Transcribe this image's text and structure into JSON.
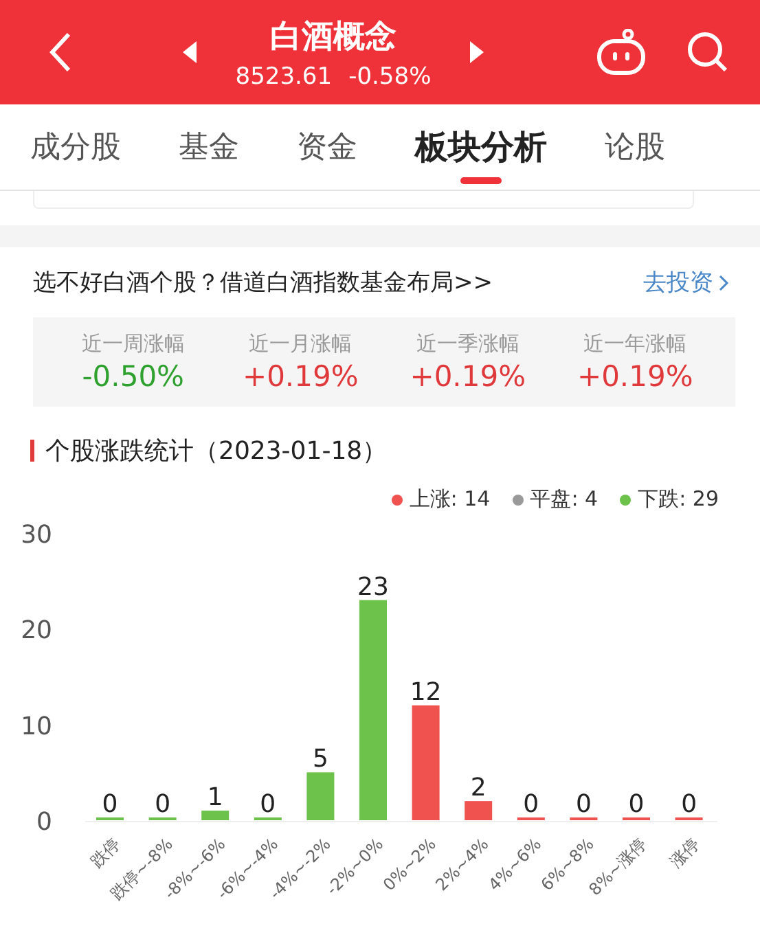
{
  "header": {
    "title": "白酒概念",
    "price": "8523.61",
    "change": "-0.58%"
  },
  "tabs": [
    {
      "label": "成分股",
      "selected": false
    },
    {
      "label": "基金",
      "selected": false
    },
    {
      "label": "资金",
      "selected": false
    },
    {
      "label": "板块分析",
      "selected": true
    },
    {
      "label": "论股",
      "selected": false
    }
  ],
  "promo": {
    "text": "选不好白酒个股？借道白酒指数基金布局>>",
    "link": "去投资"
  },
  "returns": [
    {
      "label": "近一周涨幅",
      "value": "-0.50%",
      "color": "#2ea12e"
    },
    {
      "label": "近一月涨幅",
      "value": "+0.19%",
      "color": "#e0393b"
    },
    {
      "label": "近一季涨幅",
      "value": "+0.19%",
      "color": "#e0393b"
    },
    {
      "label": "近一年涨幅",
      "value": "+0.19%",
      "color": "#e0393b"
    }
  ],
  "stats": {
    "title": "个股涨跌统计（2023-01-18）",
    "legend": [
      {
        "label": "上涨: 14",
        "color": "#f0524f"
      },
      {
        "label": "平盘: 4",
        "color": "#9a9a9a"
      },
      {
        "label": "下跌: 29",
        "color": "#6cc24a"
      }
    ],
    "chart_data": {
      "type": "bar",
      "categories": [
        "跌停",
        "跌停~-8%",
        "-8%~-6%",
        "-6%~-4%",
        "-4%~-2%",
        "-2%~0%",
        "0%~2%",
        "2%~4%",
        "4%~6%",
        "6%~8%",
        "8%~涨停",
        "涨停"
      ],
      "series": [
        {
          "color": "#6cc24a",
          "values": [
            0,
            0,
            1,
            0,
            5,
            23,
            null,
            null,
            null,
            null,
            null,
            null
          ]
        },
        {
          "color": "#f0524f",
          "values": [
            null,
            null,
            null,
            null,
            null,
            null,
            12,
            2,
            0,
            0,
            0,
            0
          ]
        }
      ],
      "ylim": [
        0,
        30
      ],
      "yticks": [
        0,
        10,
        20,
        30
      ],
      "data_labels": true
    }
  }
}
